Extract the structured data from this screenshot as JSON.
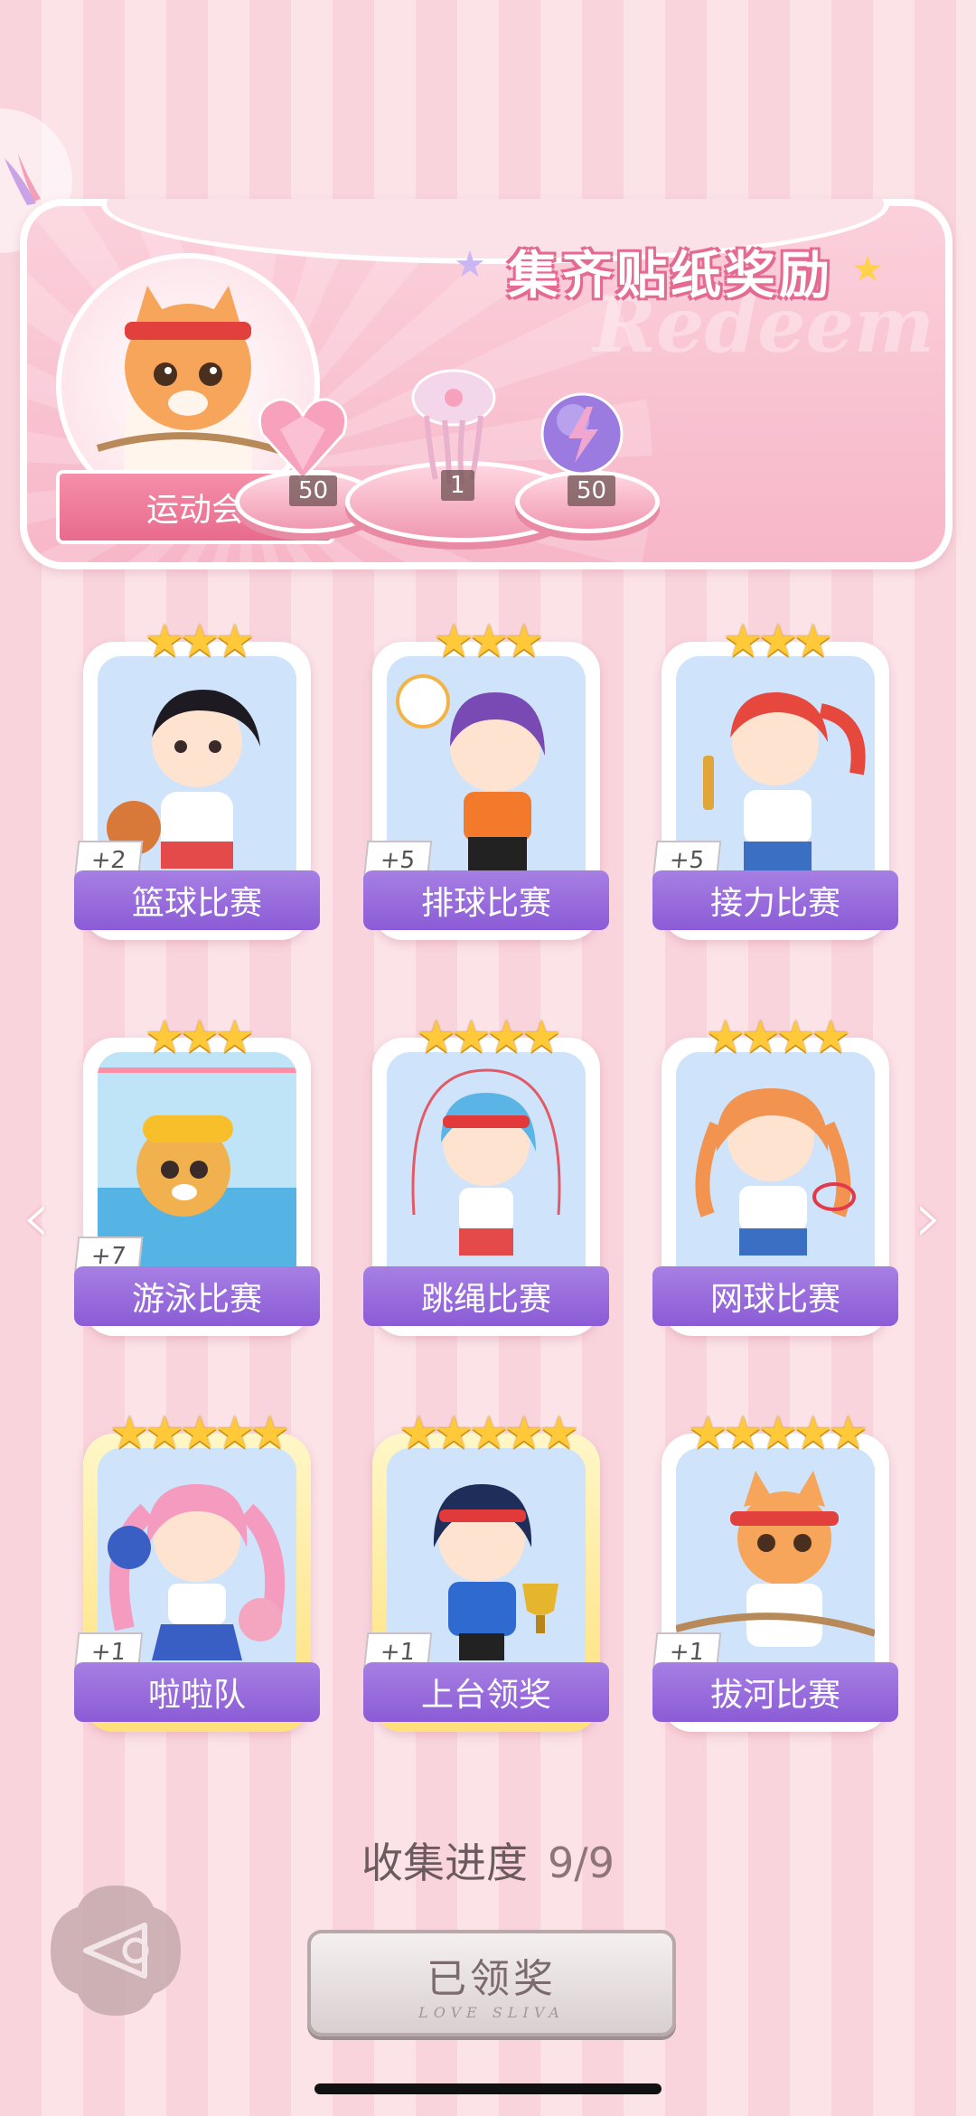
{
  "banner": {
    "title": "集齐贴纸奖励",
    "watermark": "Redeem",
    "event_name": "运动会",
    "rewards": [
      {
        "name": "heart-gem",
        "count": "50"
      },
      {
        "name": "jellyfish-plush",
        "count": "1"
      },
      {
        "name": "lightning-orb",
        "count": "50"
      }
    ]
  },
  "cards": [
    {
      "label": "篮球比赛",
      "plus": "+2",
      "stars": "★★★"
    },
    {
      "label": "排球比赛",
      "plus": "+5",
      "stars": "★★★"
    },
    {
      "label": "接力比赛",
      "plus": "+5",
      "stars": "★★★"
    },
    {
      "label": "游泳比赛",
      "plus": "+7",
      "stars": "★★★"
    },
    {
      "label": "跳绳比赛",
      "plus": "",
      "stars": "★★★★"
    },
    {
      "label": "网球比赛",
      "plus": "",
      "stars": "★★★★"
    },
    {
      "label": "啦啦队",
      "plus": "+1",
      "stars": "★★★★★"
    },
    {
      "label": "上台领奖",
      "plus": "+1",
      "stars": "★★★★★"
    },
    {
      "label": "拔河比赛",
      "plus": "+1",
      "stars": "★★★★★"
    }
  ],
  "progress": {
    "label": "收集进度",
    "value": "9/9"
  },
  "claim_button": {
    "label": "已领奖",
    "sub": "LOVE SLIVA"
  },
  "colors": {
    "accent": "#8b5cd6",
    "pink": "#f7b6c8",
    "gold": "#ffc93a"
  }
}
